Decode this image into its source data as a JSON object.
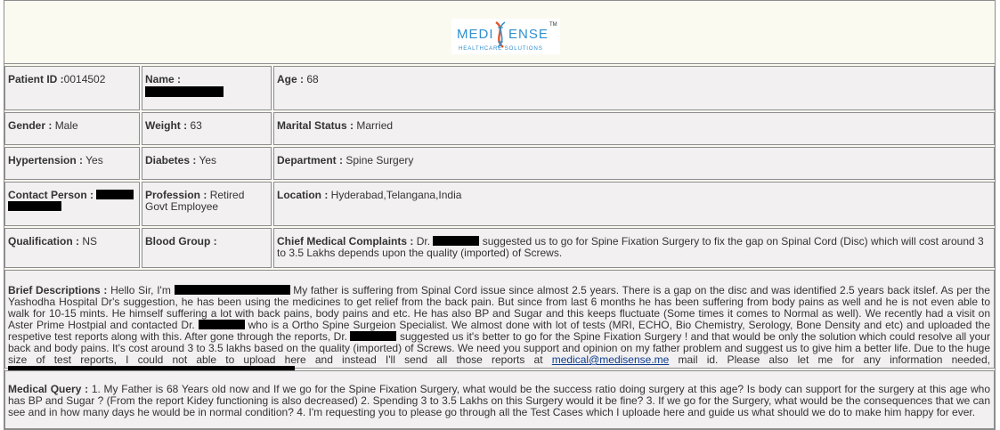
{
  "brand": {
    "name_left": "MEDI",
    "name_right": "ENSE",
    "tagline": "HEALTHCARE SOLUTIONS",
    "tm": "TM",
    "primary_color": "#2f8fcf",
    "accent_color": "#e0572b"
  },
  "patient": {
    "patient_id_label": "Patient ID :",
    "patient_id_value": "0014502",
    "name_label": "Name :",
    "age_label": "Age :",
    "age_value": "68",
    "gender_label": "Gender :",
    "gender_value": "Male",
    "weight_label": "Weight :",
    "weight_value": "63",
    "marital_label": "Marital Status :",
    "marital_value": "Married",
    "hypertension_label": "Hypertension :",
    "hypertension_value": "Yes",
    "diabetes_label": "Diabetes :",
    "diabetes_value": "Yes",
    "department_label": "Department :",
    "department_value": "Spine Surgery",
    "contact_label": "Contact Person :",
    "profession_label": "Profession :",
    "profession_value": "Retired Govt Employee",
    "location_label": "Location :",
    "location_value": "Hyderabad,Telangana,India",
    "qualification_label": "Qualification :",
    "qualification_value": "NS",
    "blood_group_label": "Blood Group :",
    "chief_label": "Chief Medical Complaints :",
    "chief_prefix": "Dr.",
    "chief_value": "suggested us to go for Spine Fixation Surgery to fix the gap on Spinal Cord (Disc) which will cost around 3 to 3.5 Lakhs depends upon the quality (imported) of Screws."
  },
  "brief": {
    "label": "Brief Descriptions :",
    "greeting": "Hello Sir, I'm",
    "part1": "My father is suffering from Spinal Cord issue since almost 2.5 years. There is a gap on the disc and was identified 2.5 years back itslef. As per the Yashodha Hospital Dr's suggestion, he has been using the medicines to get relief from the back pain. But since from last 6 months he has been suffering from body pains as well and he is not even able to walk for 10-15 mints. He himself suffering a lot with back pains, body pains and etc. He has also BP and Sugar and this keeps fluctuate (Some times it comes to Normal as well). We recently had a visit on Aster Prime Hostpial and contacted Dr.",
    "part2": "who is a Ortho Spine Surgeion Specialist. We almost done with lot of tests (MRI, ECHO, Bio Chemistry, Serology, Bone Density and etc) and uploaded the respetive test reports along with this. After gone through the reports, Dr.",
    "part3": "suggested us it's better to go for the Spine Fixation Surgery ! and that would be only the solution which could resolve all your back and body pains. It's cost around 3 to 3.5 lakhs based on the quality (imported) of Screws. We need you support and opinion on my father problem and suggest us to give him a better life. Due to the huge size of test reports, I could not able to upload here and instead I'll send all those reports at",
    "email": "medical@medisense.me",
    "part4": "mail id. Please also let me for any information needed,"
  },
  "query": {
    "label": "Medical Query :",
    "text": "1. My Father is 68 Years old now and If we go for the Spine Fixation Surgery, what would be the success ratio doing surgery at this age? Is body can support for the surgery at this age who has BP and Sugar ? (From the report Kidey functioning is also decreased) 2. Spending 3 to 3.5 Lakhs on this Surgery would it be fine? 3. If we go for the Surgery, what would be the consequences that we can see and in how many days he would be in normal condition? 4. I'm requesting you to please go through all the Test Cases which I uploade here and guide us what should we do to make him happy for ever."
  }
}
